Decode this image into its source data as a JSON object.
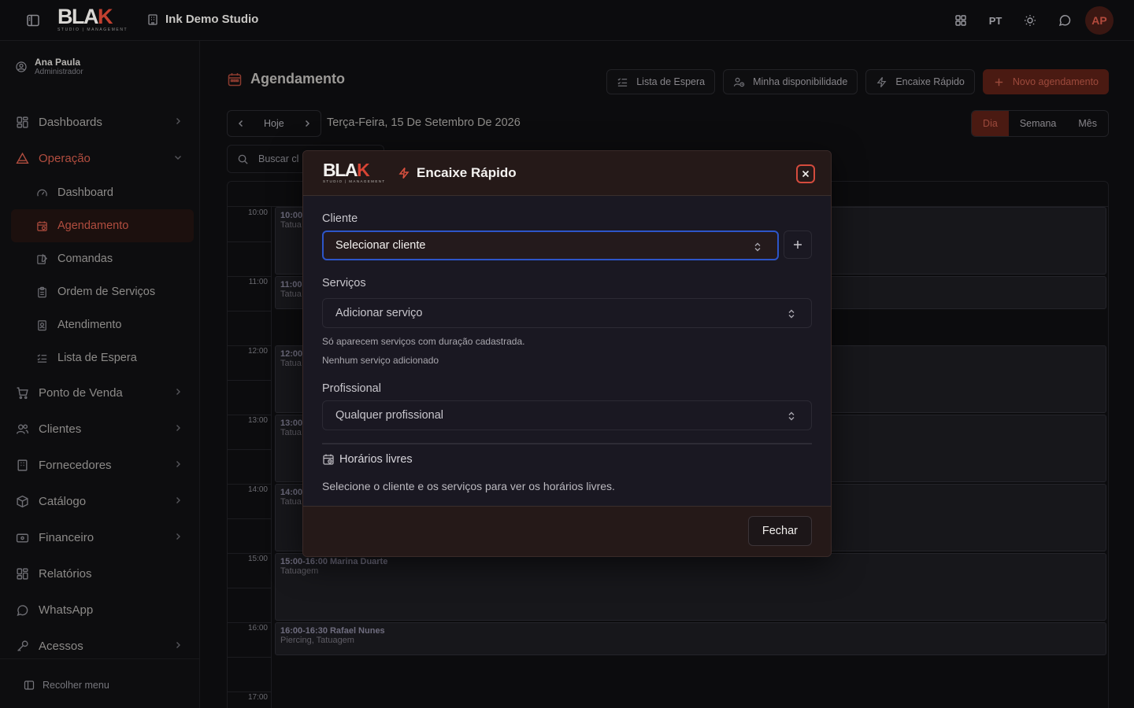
{
  "app": {
    "logo_word_main": "BLA",
    "logo_word_k": "K",
    "logo_word_end": "K",
    "logo_sub": "STUDIO | MANAGEMENT",
    "studio_name": "Ink Demo Studio",
    "lang": "PT",
    "avatar_initials": "AP"
  },
  "user": {
    "name": "Ana Paula",
    "role": "Administrador"
  },
  "sidebar": {
    "items": [
      {
        "label": "Dashboards",
        "icon": "grid-icon",
        "chevron": true
      },
      {
        "label": "Operação",
        "icon": "warning-triangle-icon",
        "chevron": true,
        "open": true
      },
      {
        "label": "Ponto de Venda",
        "icon": "cart-icon",
        "chevron": true
      },
      {
        "label": "Clientes",
        "icon": "users-icon",
        "chevron": true
      },
      {
        "label": "Fornecedores",
        "icon": "building-icon",
        "chevron": true
      },
      {
        "label": "Catálogo",
        "icon": "package-icon",
        "chevron": true
      },
      {
        "label": "Financeiro",
        "icon": "wallet-icon",
        "chevron": true
      },
      {
        "label": "Relatórios",
        "icon": "report-icon",
        "chevron": false
      },
      {
        "label": "WhatsApp",
        "icon": "chat-icon",
        "chevron": false
      },
      {
        "label": "Acessos",
        "icon": "key-icon",
        "chevron": true
      }
    ],
    "sub_items": [
      {
        "label": "Dashboard",
        "icon": "gauge-icon"
      },
      {
        "label": "Agendamento",
        "icon": "calendar-icon",
        "active": true
      },
      {
        "label": "Comandas",
        "icon": "edit-icon"
      },
      {
        "label": "Ordem de Serviços",
        "icon": "clipboard-icon"
      },
      {
        "label": "Atendimento",
        "icon": "service-icon"
      },
      {
        "label": "Lista de Espera",
        "icon": "list-icon"
      }
    ],
    "collapse_label": "Recolher menu"
  },
  "page": {
    "title": "Agendamento",
    "actions": {
      "waitlist": "Lista de Espera",
      "availability": "Minha disponibilidade",
      "quick_fit": "Encaixe Rápido",
      "new_appointment": "Novo agendamento"
    },
    "today": "Hoje",
    "date_label": "Terça-Feira, 15 De Setembro De 2026",
    "views": [
      "Dia",
      "Semana",
      "Mês"
    ],
    "active_view": "Dia",
    "search_placeholder": "Buscar cl"
  },
  "calendar": {
    "hours": [
      "10:00",
      "11:00",
      "12:00",
      "13:00",
      "14:00",
      "15:00",
      "16:00",
      "17:00"
    ],
    "events": [
      {
        "time": "10:00",
        "service": "Tatua"
      },
      {
        "time": "11:00-",
        "service": "Tatua"
      },
      {
        "time": "12:00",
        "service": "Tatua"
      },
      {
        "time": "13:00",
        "service": "Tatua"
      },
      {
        "time": "14:00",
        "service": "Tatua"
      },
      {
        "time": "15:00-16:00 Marina Duarte",
        "service": "Tatuagem"
      },
      {
        "time": "16:00-16:30 Rafael Nunes",
        "service": "Piercing, Tatuagem"
      }
    ]
  },
  "modal": {
    "title": "Encaixe Rápido",
    "cliente_label": "Cliente",
    "cliente_value": "Selecionar cliente",
    "servicos_label": "Serviços",
    "servicos_value": "Adicionar serviço",
    "servicos_hint": "Só aparecem serviços com duração cadastrada.",
    "servicos_empty": "Nenhum serviço adicionado",
    "profissional_label": "Profissional",
    "profissional_value": "Qualquer profissional",
    "slots_title": "Horários livres",
    "slots_msg": "Selecione o cliente e os serviços para ver os horários livres.",
    "close_label": "Fechar"
  }
}
